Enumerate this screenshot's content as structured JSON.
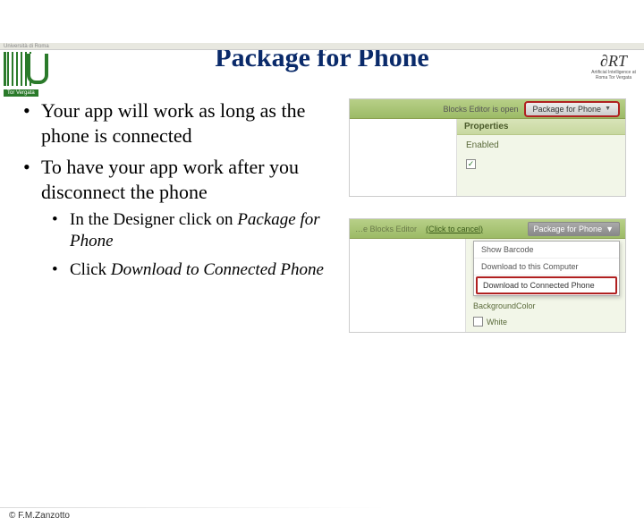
{
  "header": {
    "tiny_top": "Università di Roma",
    "logo_left_label": "Tor Vergata",
    "logo_right_main": "∂RT",
    "logo_right_sub": "Artificial Intelligence at Roma Tor Vergata"
  },
  "title": "Package for Phone",
  "bullets": {
    "b1": "Your app will work as long as the phone is connected",
    "b2": "To have your app work after you disconnect the phone",
    "s1_pre": "In the Designer click on ",
    "s1_em": "Package for Phone",
    "s2_pre": "Click ",
    "s2_em": "Download to Connected Phone"
  },
  "shot1": {
    "bar_text": "Blocks Editor is open",
    "pkg_btn": "Package for Phone",
    "props_header": "Properties",
    "enabled_label": "Enabled",
    "check_glyph": "✓"
  },
  "shot2": {
    "bar_light": "…e Blocks Editor",
    "bar_link": "(Click to cancel)",
    "pkg_btn": "Package for Phone",
    "menu": {
      "m1": "Show Barcode",
      "m2": "Download to this Computer",
      "m3": "Download to Connected Phone"
    },
    "bg_label": "BackgroundColor",
    "bg_value": "White"
  },
  "footer": "© F.M.Zanzotto"
}
